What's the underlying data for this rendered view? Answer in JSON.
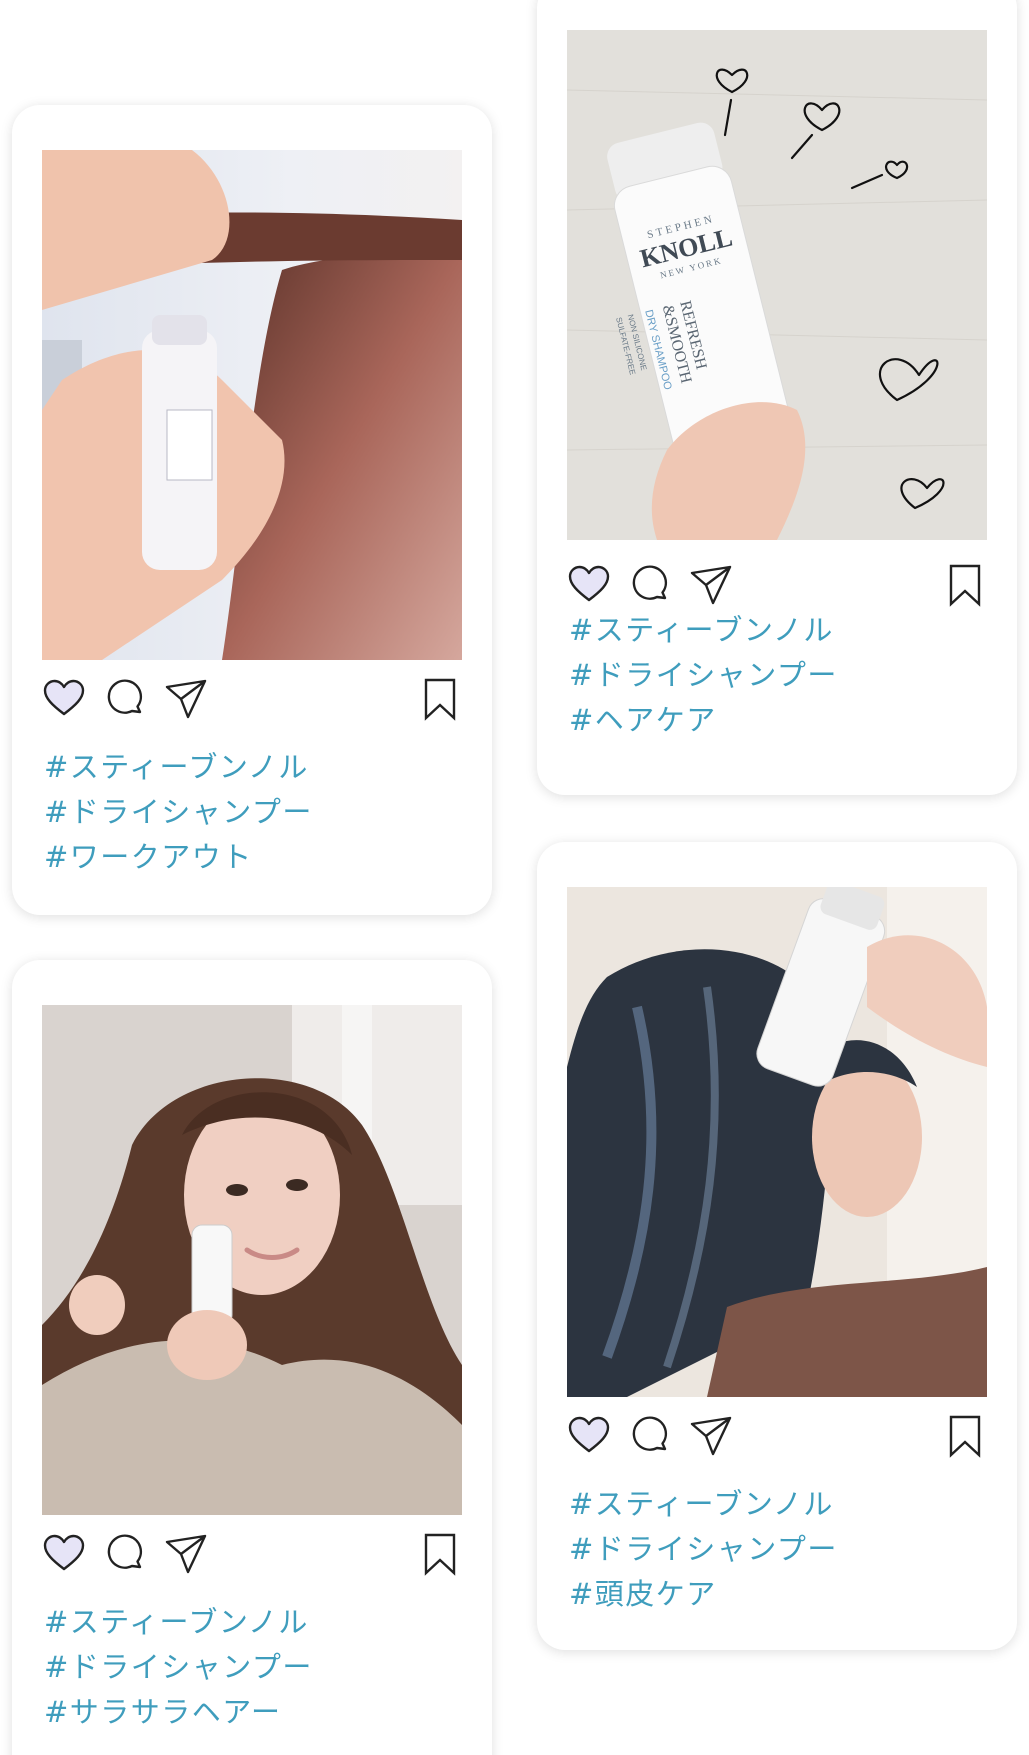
{
  "posts": [
    {
      "photo": "woman-spraying-dry-shampoo-into-parted-brown-hair",
      "tags": [
        "#スティーブンノル",
        "#ドライシャンプー",
        "#ワークアウト"
      ]
    },
    {
      "photo": "hand-holding-stephen-knoll-dry-shampoo-bottle-with-hearts",
      "bottle_text": {
        "brand_top": "STEPHEN",
        "brand": "KNOLL",
        "brand_bottom": "NEW YORK",
        "line1": "REFRESH",
        "line2": "&SMOOTH",
        "line3": "DRY SHAMPOO",
        "line4": "NON SILICONE",
        "line5": "SULFATE-FREE"
      },
      "tags": [
        "#スティーブンノル",
        "#ドライシャンプー",
        "#ヘアケア"
      ]
    },
    {
      "photo": "woman-with-long-brown-hair-spraying-near-ear",
      "tags": [
        "#スティーブンノル",
        "#ドライシャンプー",
        "#サラサラヘアー"
      ]
    },
    {
      "photo": "woman-with-dark-hair-spraying-scalp",
      "tags": [
        "#スティーブンノル",
        "#ドライシャンプー",
        "#頭皮ケア"
      ]
    }
  ],
  "icons": {
    "like": "heart-icon",
    "comment": "comment-icon",
    "share": "send-icon",
    "save": "bookmark-icon"
  },
  "colors": {
    "tag": "#3f9dbd",
    "heart_fill": "#e6e4f7",
    "icon_stroke": "#222222",
    "card_bg": "#ffffff"
  }
}
